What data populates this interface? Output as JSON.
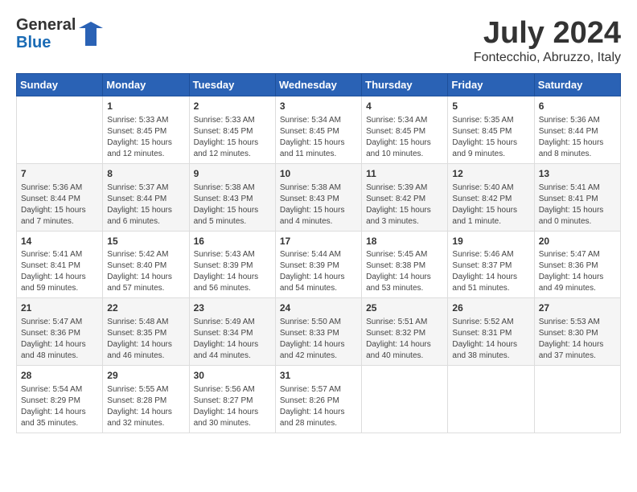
{
  "logo": {
    "general": "General",
    "blue": "Blue"
  },
  "header": {
    "month": "July 2024",
    "location": "Fontecchio, Abruzzo, Italy"
  },
  "weekdays": [
    "Sunday",
    "Monday",
    "Tuesday",
    "Wednesday",
    "Thursday",
    "Friday",
    "Saturday"
  ],
  "weeks": [
    [
      {
        "day": "",
        "info": ""
      },
      {
        "day": "1",
        "info": "Sunrise: 5:33 AM\nSunset: 8:45 PM\nDaylight: 15 hours\nand 12 minutes."
      },
      {
        "day": "2",
        "info": "Sunrise: 5:33 AM\nSunset: 8:45 PM\nDaylight: 15 hours\nand 12 minutes."
      },
      {
        "day": "3",
        "info": "Sunrise: 5:34 AM\nSunset: 8:45 PM\nDaylight: 15 hours\nand 11 minutes."
      },
      {
        "day": "4",
        "info": "Sunrise: 5:34 AM\nSunset: 8:45 PM\nDaylight: 15 hours\nand 10 minutes."
      },
      {
        "day": "5",
        "info": "Sunrise: 5:35 AM\nSunset: 8:45 PM\nDaylight: 15 hours\nand 9 minutes."
      },
      {
        "day": "6",
        "info": "Sunrise: 5:36 AM\nSunset: 8:44 PM\nDaylight: 15 hours\nand 8 minutes."
      }
    ],
    [
      {
        "day": "7",
        "info": "Sunrise: 5:36 AM\nSunset: 8:44 PM\nDaylight: 15 hours\nand 7 minutes."
      },
      {
        "day": "8",
        "info": "Sunrise: 5:37 AM\nSunset: 8:44 PM\nDaylight: 15 hours\nand 6 minutes."
      },
      {
        "day": "9",
        "info": "Sunrise: 5:38 AM\nSunset: 8:43 PM\nDaylight: 15 hours\nand 5 minutes."
      },
      {
        "day": "10",
        "info": "Sunrise: 5:38 AM\nSunset: 8:43 PM\nDaylight: 15 hours\nand 4 minutes."
      },
      {
        "day": "11",
        "info": "Sunrise: 5:39 AM\nSunset: 8:42 PM\nDaylight: 15 hours\nand 3 minutes."
      },
      {
        "day": "12",
        "info": "Sunrise: 5:40 AM\nSunset: 8:42 PM\nDaylight: 15 hours\nand 1 minute."
      },
      {
        "day": "13",
        "info": "Sunrise: 5:41 AM\nSunset: 8:41 PM\nDaylight: 15 hours\nand 0 minutes."
      }
    ],
    [
      {
        "day": "14",
        "info": "Sunrise: 5:41 AM\nSunset: 8:41 PM\nDaylight: 14 hours\nand 59 minutes."
      },
      {
        "day": "15",
        "info": "Sunrise: 5:42 AM\nSunset: 8:40 PM\nDaylight: 14 hours\nand 57 minutes."
      },
      {
        "day": "16",
        "info": "Sunrise: 5:43 AM\nSunset: 8:39 PM\nDaylight: 14 hours\nand 56 minutes."
      },
      {
        "day": "17",
        "info": "Sunrise: 5:44 AM\nSunset: 8:39 PM\nDaylight: 14 hours\nand 54 minutes."
      },
      {
        "day": "18",
        "info": "Sunrise: 5:45 AM\nSunset: 8:38 PM\nDaylight: 14 hours\nand 53 minutes."
      },
      {
        "day": "19",
        "info": "Sunrise: 5:46 AM\nSunset: 8:37 PM\nDaylight: 14 hours\nand 51 minutes."
      },
      {
        "day": "20",
        "info": "Sunrise: 5:47 AM\nSunset: 8:36 PM\nDaylight: 14 hours\nand 49 minutes."
      }
    ],
    [
      {
        "day": "21",
        "info": "Sunrise: 5:47 AM\nSunset: 8:36 PM\nDaylight: 14 hours\nand 48 minutes."
      },
      {
        "day": "22",
        "info": "Sunrise: 5:48 AM\nSunset: 8:35 PM\nDaylight: 14 hours\nand 46 minutes."
      },
      {
        "day": "23",
        "info": "Sunrise: 5:49 AM\nSunset: 8:34 PM\nDaylight: 14 hours\nand 44 minutes."
      },
      {
        "day": "24",
        "info": "Sunrise: 5:50 AM\nSunset: 8:33 PM\nDaylight: 14 hours\nand 42 minutes."
      },
      {
        "day": "25",
        "info": "Sunrise: 5:51 AM\nSunset: 8:32 PM\nDaylight: 14 hours\nand 40 minutes."
      },
      {
        "day": "26",
        "info": "Sunrise: 5:52 AM\nSunset: 8:31 PM\nDaylight: 14 hours\nand 38 minutes."
      },
      {
        "day": "27",
        "info": "Sunrise: 5:53 AM\nSunset: 8:30 PM\nDaylight: 14 hours\nand 37 minutes."
      }
    ],
    [
      {
        "day": "28",
        "info": "Sunrise: 5:54 AM\nSunset: 8:29 PM\nDaylight: 14 hours\nand 35 minutes."
      },
      {
        "day": "29",
        "info": "Sunrise: 5:55 AM\nSunset: 8:28 PM\nDaylight: 14 hours\nand 32 minutes."
      },
      {
        "day": "30",
        "info": "Sunrise: 5:56 AM\nSunset: 8:27 PM\nDaylight: 14 hours\nand 30 minutes."
      },
      {
        "day": "31",
        "info": "Sunrise: 5:57 AM\nSunset: 8:26 PM\nDaylight: 14 hours\nand 28 minutes."
      },
      {
        "day": "",
        "info": ""
      },
      {
        "day": "",
        "info": ""
      },
      {
        "day": "",
        "info": ""
      }
    ]
  ]
}
